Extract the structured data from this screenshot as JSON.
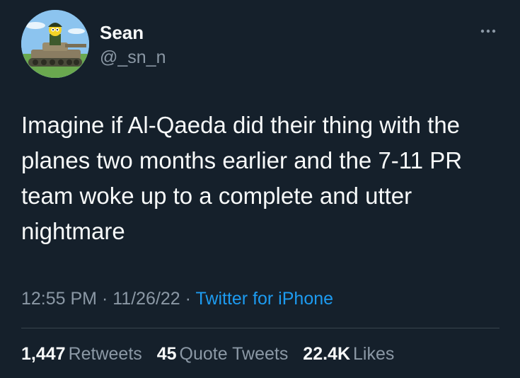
{
  "author": {
    "display_name": "Sean",
    "handle": "@_sn_n",
    "avatar_icon": "cartoon-character-on-tank-avatar"
  },
  "more_icon": "more-horizontal-icon",
  "tweet": {
    "text": "Imagine if Al-Qaeda did their thing with the planes two months earlier and the 7-11 PR team woke up to a complete and utter nightmare",
    "time": "12:55 PM",
    "separator": "·",
    "date": "11/26/22",
    "source": "Twitter for iPhone"
  },
  "stats": {
    "retweets_count": "1,447",
    "retweets_label": "Retweets",
    "quotes_count": "45",
    "quotes_label": "Quote Tweets",
    "likes_count": "22.4K",
    "likes_label": "Likes"
  },
  "colors": {
    "background": "#15202b",
    "primary_text": "#f7f9f9",
    "secondary_text": "#8b98a5",
    "link": "#1d9bf0",
    "divider": "#38444d"
  }
}
